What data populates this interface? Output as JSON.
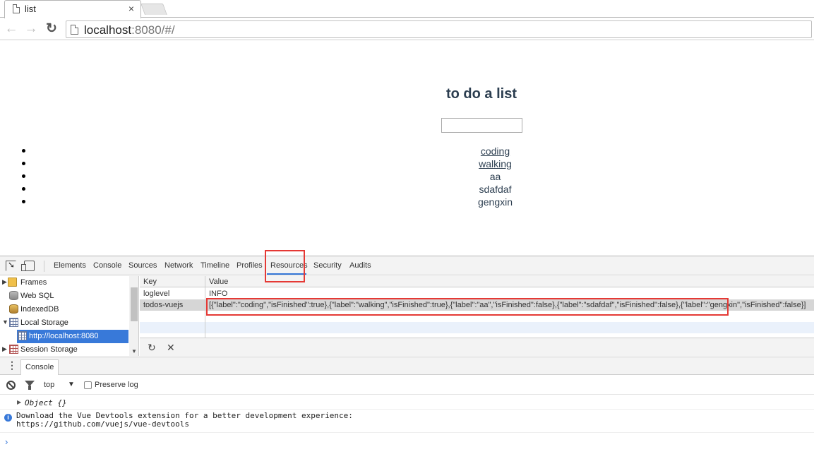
{
  "browser": {
    "tab_title": "list",
    "tab_close": "×",
    "url_host": "localhost",
    "url_rest": ":8080/#/"
  },
  "app": {
    "title": "to do a list",
    "input_value": "",
    "items": [
      {
        "label": "coding",
        "isFinished": true
      },
      {
        "label": "walking",
        "isFinished": true
      },
      {
        "label": "aa",
        "isFinished": false
      },
      {
        "label": "sdafdaf",
        "isFinished": false
      },
      {
        "label": "gengxin",
        "isFinished": false
      }
    ]
  },
  "devtools": {
    "tabs": [
      "Elements",
      "Console",
      "Sources",
      "Network",
      "Timeline",
      "Profiles",
      "Resources",
      "Security",
      "Audits"
    ],
    "active_tab": "Resources",
    "sidebar": [
      {
        "label": "Frames",
        "icon": "folder-icon",
        "expandable": true
      },
      {
        "label": "Web SQL",
        "icon": "database-icon"
      },
      {
        "label": "IndexedDB",
        "icon": "database-icon"
      },
      {
        "label": "Local Storage",
        "icon": "grid-icon",
        "expanded": true
      },
      {
        "label": "http://localhost:8080",
        "icon": "grid-icon",
        "selected": true
      },
      {
        "label": "Session Storage",
        "icon": "grid-icon",
        "expandable": true
      }
    ],
    "table": {
      "col_key": "Key",
      "col_value": "Value",
      "rows": [
        {
          "key": "loglevel",
          "value": "INFO"
        },
        {
          "key": "todos-vuejs",
          "value": "[{\"label\":\"coding\",\"isFinished\":true},{\"label\":\"walking\",\"isFinished\":true},{\"label\":\"aa\",\"isFinished\":false},{\"label\":\"sdafdaf\",\"isFinished\":false},{\"label\":\"gengxin\",\"isFinished\":false}]"
        }
      ]
    },
    "drawer_tab": "Console",
    "console_toolbar": {
      "context": "top",
      "preserve_log": "Preserve log"
    },
    "console_messages": {
      "object": "Object {}",
      "info": "Download the Vue Devtools extension for a better development experience:\nhttps://github.com/vuejs/vue-devtools"
    },
    "prompt": "›"
  },
  "colors": {
    "accent": "#3879d9",
    "highlight_box": "#e53935",
    "heading": "#2c3e50"
  }
}
